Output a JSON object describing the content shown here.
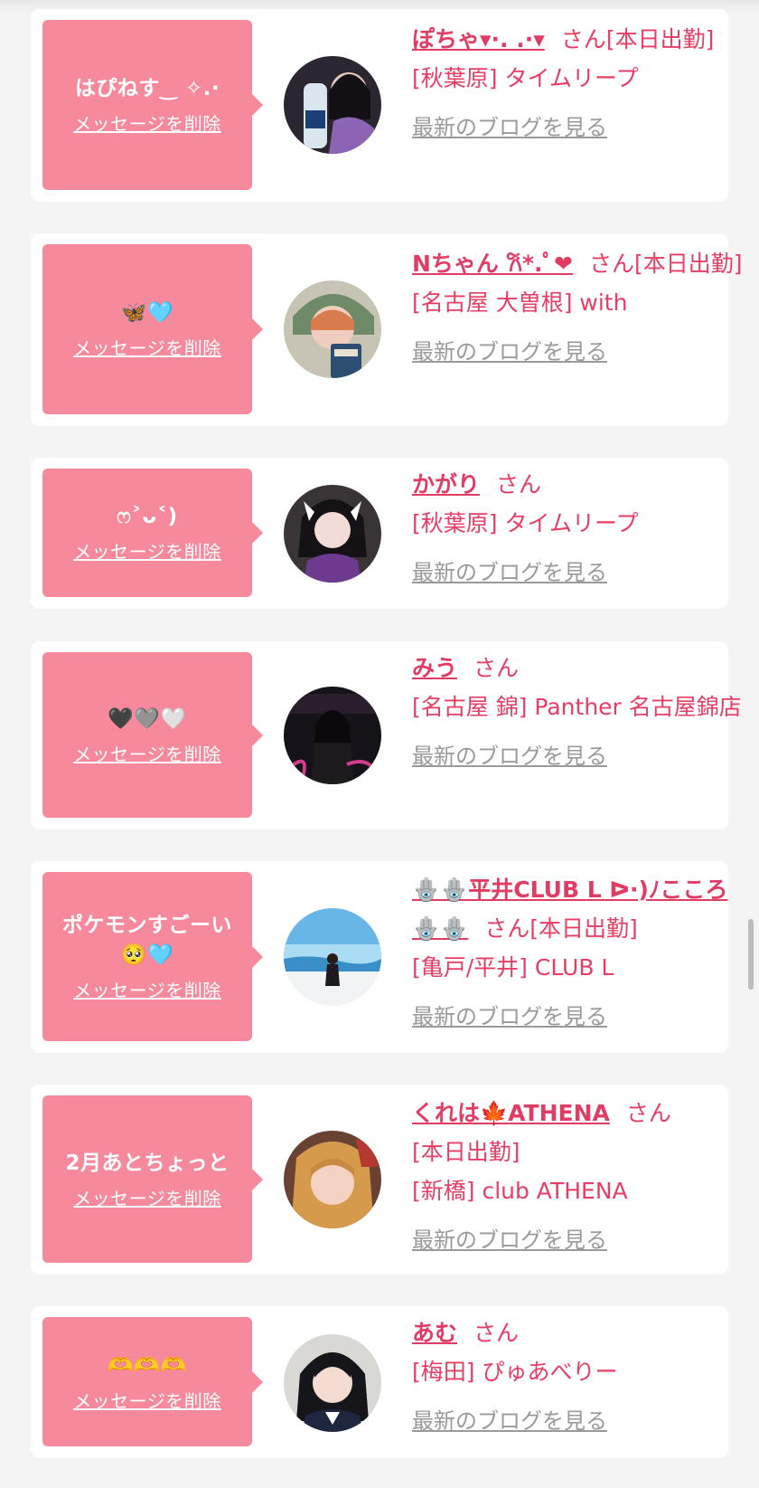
{
  "delete_label": "メッセージを削除",
  "blog_label": "最新のブログを見る",
  "san_label": "さん",
  "colors": {
    "page_bg": "#f4f4f4",
    "bubble": "#f7899c",
    "accent": "#e13c64",
    "link_gray": "#9a9a9a"
  },
  "items": [
    {
      "message": "はぴねす‿ ✧.·",
      "name": "ぽちゃ▾·. .·▾",
      "status": "[本日出勤]",
      "shop": "[秋葉原] タイムリープ"
    },
    {
      "message": "🦋🩵",
      "name": "Nちゃん 𐙚*.ﾟ❤",
      "status": "[本日出勤]",
      "shop": "[名古屋 大曽根] with"
    },
    {
      "message": "ෆ˃ᴗ˂)",
      "name": "かがり",
      "status": "",
      "shop": "[秋葉原] タイムリープ"
    },
    {
      "message": "🖤🩶🤍",
      "name": "みう",
      "status": "",
      "shop": "[名古屋 錦] Panther 名古屋錦店"
    },
    {
      "message": "ポケモンすごーい🥺🩵",
      "name": "🪬🪬平井CLUB L ᐅ·)ﾉこころ🪬🪬",
      "status": "[本日出勤]",
      "shop": "[亀戸/平井] CLUB L"
    },
    {
      "message": "2月あとちょっと",
      "name": "くれは🍁ATHENA",
      "status": "[本日出勤]",
      "shop": "[新橋] club ATHENA"
    },
    {
      "message": "🫶🫶🫶",
      "name": "あむ",
      "status": "",
      "shop": "[梅田] ぴゅあべりー"
    }
  ]
}
